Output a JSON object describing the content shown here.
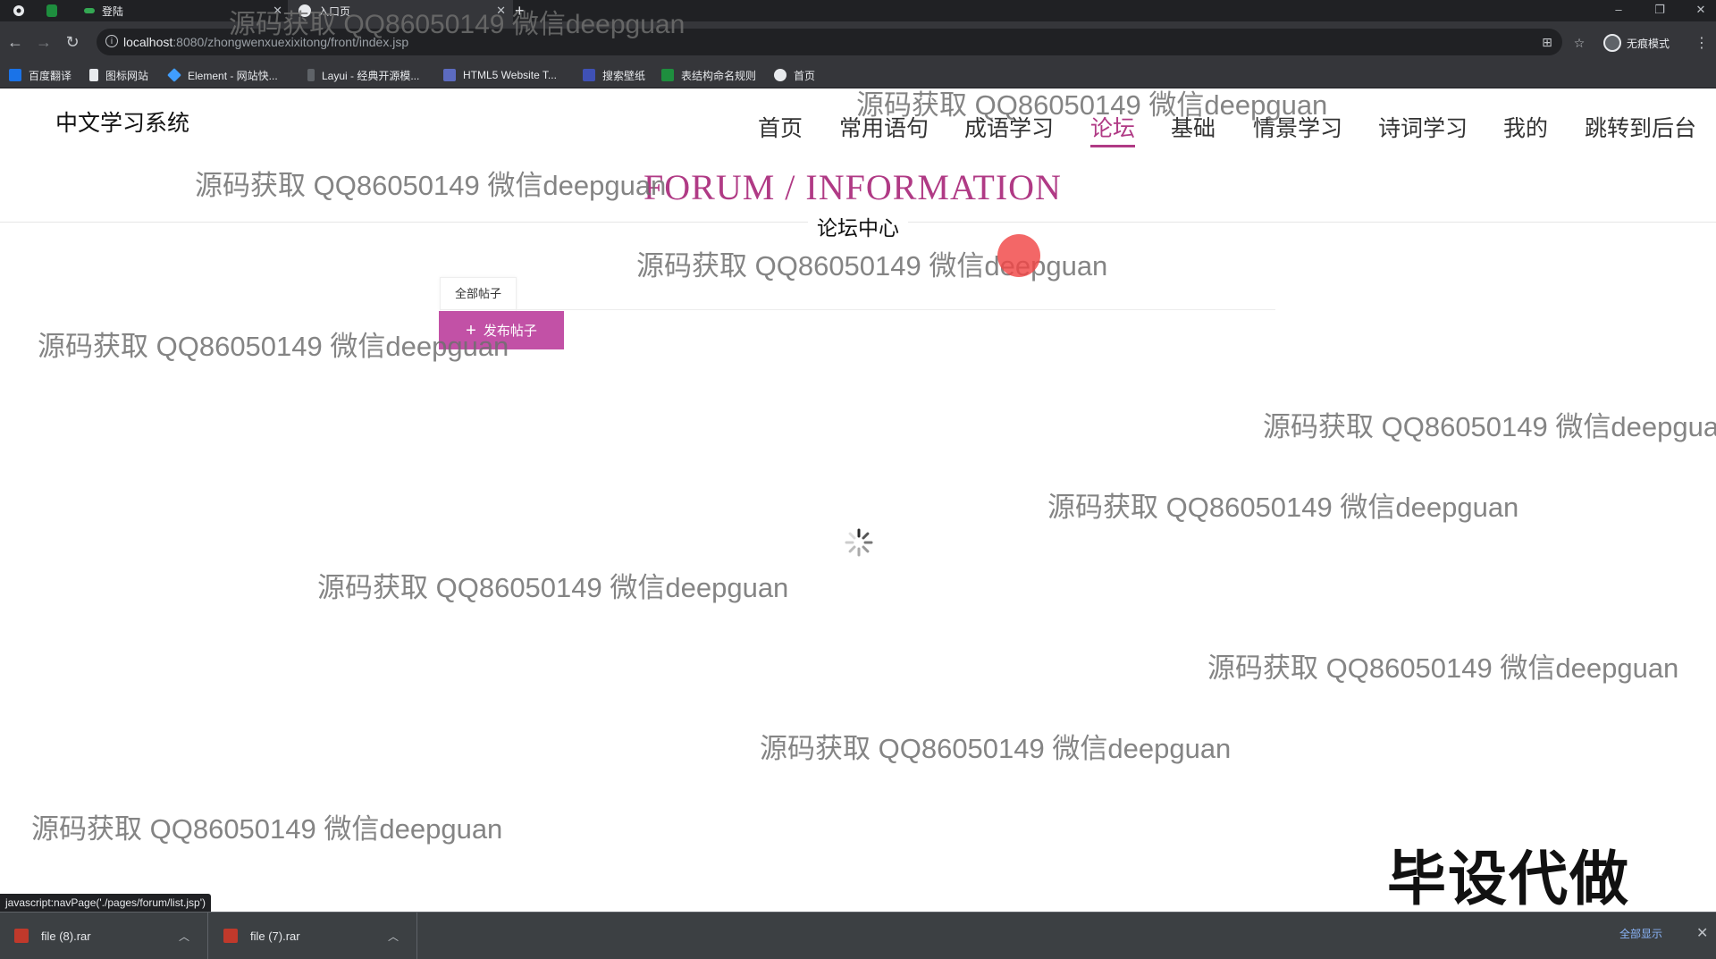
{
  "browser": {
    "tabs": [
      {
        "label": "登陆",
        "active": false
      },
      {
        "label": "入口页",
        "active": true
      }
    ],
    "new_tab_icon": "plus-icon",
    "url_host": "localhost",
    "url_path": ":8080/zhongwenxuexixitong/front/index.jsp",
    "profile_label": "无痕模式",
    "bookmarks": [
      "百度翻译",
      "图标网站",
      "Element - 网站快...",
      "Layui - 经典开源模...",
      "HTML5 Website T...",
      "搜索壁纸",
      "表结构命名规则",
      "首页"
    ]
  },
  "site": {
    "title": "中文学习系统",
    "nav": [
      "首页",
      "常用语句",
      "成语学习",
      "论坛",
      "基础",
      "情景学习",
      "诗词学习",
      "我的",
      "跳转到后台"
    ],
    "active_nav": "论坛",
    "accent_color": "#b03a85"
  },
  "forum": {
    "title": "FORUM / INFORMATION",
    "subtitle": "论坛中心",
    "tab_all": "全部帖子",
    "publish_button": "发布帖子",
    "loading_icon": "spinner-icon"
  },
  "watermark": "源码获取 QQ86050149 微信deepguan",
  "overlay_text": "毕设代做",
  "status_bar": "javascript:navPage('./pages/forum/list.jsp')",
  "downloads": {
    "items": [
      "file (8).rar",
      "file (7).rar"
    ],
    "show_all": "全部显示"
  }
}
